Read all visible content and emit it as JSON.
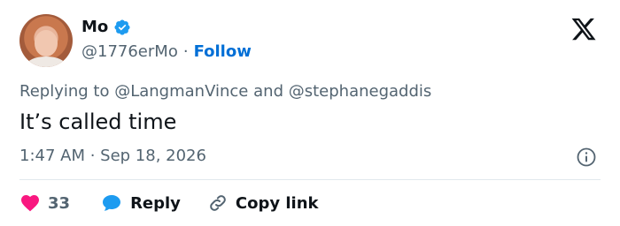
{
  "author": {
    "name": "Mo",
    "handle": "@1776erMo",
    "separator": "·",
    "follow_label": "Follow"
  },
  "reply_context": {
    "prefix": "Replying to",
    "mention_1": "@LangmanVince",
    "conjunction": "and",
    "mention_2": "@stephanegaddis"
  },
  "tweet": {
    "text": "It’s called time",
    "timestamp": "1:47 AM · Sep 18, 2026"
  },
  "actions": {
    "like_count": "33",
    "reply_label": "Reply",
    "copy_link_label": "Copy link"
  },
  "colors": {
    "verified": "#1d9bf0",
    "follow": "#006fd6",
    "like": "#f91880",
    "reply_icon": "#1d9bf0",
    "muted_text": "#536471"
  },
  "icons": [
    "verified-badge-icon",
    "x-logo-icon",
    "info-icon",
    "heart-icon",
    "reply-bubble-icon",
    "link-icon"
  ]
}
